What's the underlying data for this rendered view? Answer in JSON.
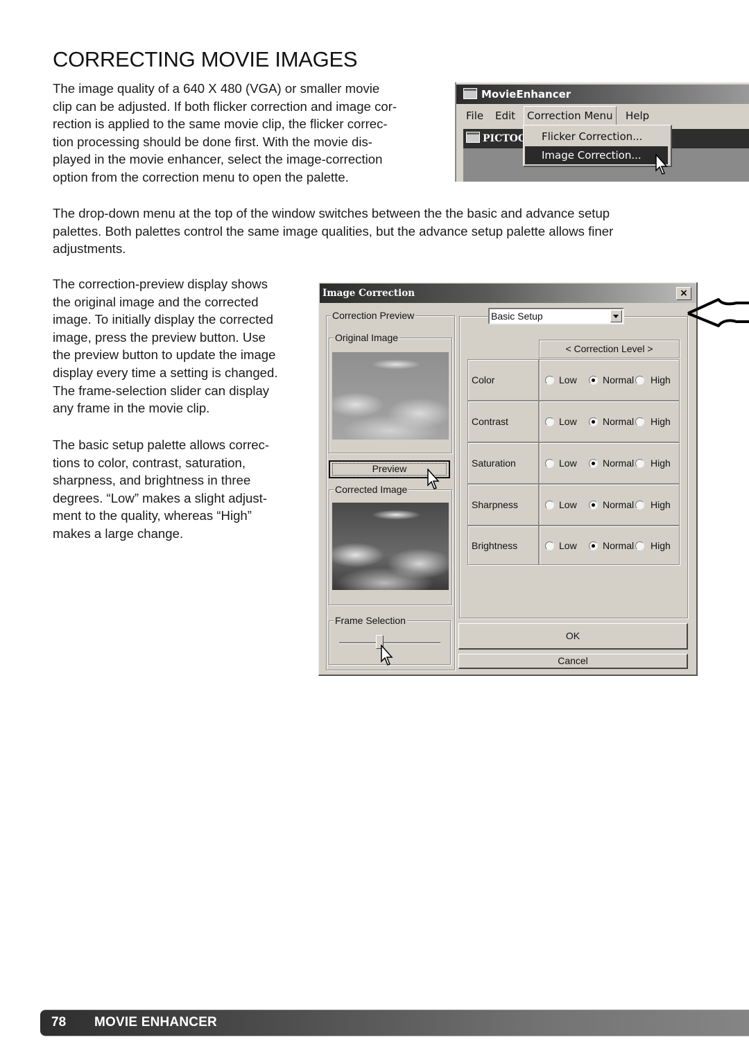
{
  "page": {
    "title": "CORRECTING MOVIE IMAGES",
    "intro_lines": [
      "The image quality of a 640 X 480 (VGA) or smaller movie",
      "clip can be adjusted. If both flicker correction and image cor-",
      "rection is applied to the same movie clip, the flicker correc-",
      "tion processing should be done first. With the movie dis-",
      "played in the movie enhancer, select the image-correction",
      "option from the correction menu to open the palette."
    ],
    "dropdown_lines": [
      "The drop-down menu at the top of the window switches between the the basic and advance setup",
      "palettes. Both palettes control the same image qualities, but the advance setup palette allows finer",
      "adjustments."
    ],
    "preview_lines": [
      "The correction-preview display shows",
      "the original image and the corrected",
      "image. To initially display the corrected",
      "image, press the preview button. Use",
      "the preview button to update the image",
      "display every time a setting is changed.",
      "The frame-selection slider can display",
      "any frame in the movie clip."
    ],
    "basic_lines": [
      "The basic setup palette allows correc-",
      "tions to color, contrast, saturation,",
      "sharpness, and brightness in three",
      "degrees. “Low” makes a slight adjust-",
      "ment to the quality, whereas “High”",
      "makes a large change."
    ],
    "footer": {
      "page_number": "78",
      "section": "MOVIE ENHANCER"
    }
  },
  "movie_enhancer": {
    "window_title": "MovieEnhancer",
    "menu": [
      "File",
      "Edit",
      "Correction Menu",
      "Help"
    ],
    "active_menu": "Correction Menu",
    "inner_window_title": "PICTOO",
    "dropdown_items": [
      "Flicker Correction...",
      "Image Correction..."
    ],
    "highlighted_item": "Image Correction..."
  },
  "image_correction": {
    "title": "Image Correction",
    "close_label": "×",
    "correction_preview_label": "Correction Preview",
    "original_image_label": "Original Image",
    "preview_button": "Preview",
    "corrected_image_label": "Corrected Image",
    "frame_selection_label": "Frame Selection",
    "frame_position_fraction": 0.4,
    "setup_select": "Basic Setup",
    "correction_level_header": "< Correction Level >",
    "options": [
      "Low",
      "Normal",
      "High"
    ],
    "rows": [
      {
        "label": "Color",
        "selected": "Normal"
      },
      {
        "label": "Contrast",
        "selected": "Normal"
      },
      {
        "label": "Saturation",
        "selected": "Normal"
      },
      {
        "label": "Sharpness",
        "selected": "Normal"
      },
      {
        "label": "Brightness",
        "selected": "Normal"
      }
    ],
    "ok_button": "OK",
    "cancel_button": "Cancel"
  }
}
